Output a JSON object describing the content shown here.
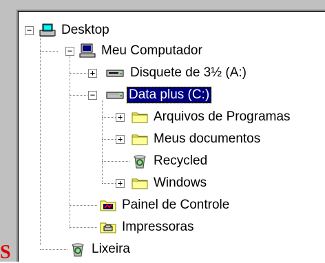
{
  "tree": {
    "desktop": "Desktop",
    "meu_computador": "Meu Computador",
    "disquete": "Disquete de 3½ (A:)",
    "data_plus": "Data plus (C:)",
    "arquivos": "Arquivos de Programas",
    "meus_documentos": "Meus documentos",
    "recycled": "Recycled",
    "windows": "Windows",
    "painel": "Painel de Controle",
    "impressoras": "Impressoras",
    "lixeira": "Lixeira"
  },
  "corner_fragment": "S",
  "colors": {
    "selection": "#000080",
    "folder": "#ffff80",
    "accent_red": "#e00000"
  }
}
